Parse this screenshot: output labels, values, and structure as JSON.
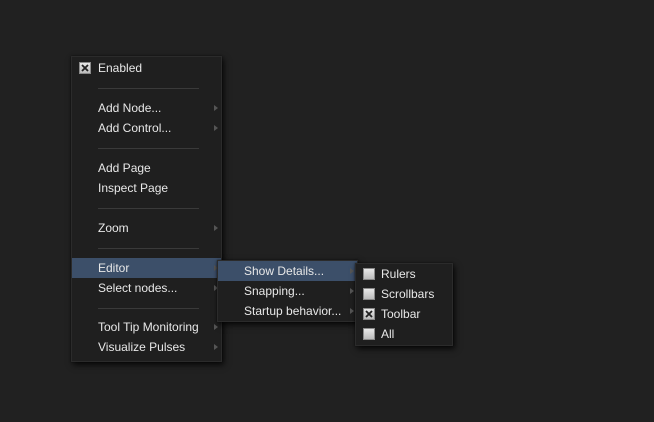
{
  "main_menu": {
    "enabled": {
      "label": "Enabled",
      "checked": true
    },
    "add_node": {
      "label": "Add Node..."
    },
    "add_control": {
      "label": "Add Control..."
    },
    "add_page": {
      "label": "Add Page"
    },
    "inspect_page": {
      "label": "Inspect Page"
    },
    "zoom": {
      "label": "Zoom"
    },
    "editor": {
      "label": "Editor"
    },
    "select_nodes": {
      "label": "Select nodes..."
    },
    "tool_tip_monitoring": {
      "label": "Tool Tip Monitoring"
    },
    "visualize_pulses": {
      "label": "Visualize Pulses"
    }
  },
  "editor_submenu": {
    "show_details": {
      "label": "Show Details..."
    },
    "snapping": {
      "label": "Snapping..."
    },
    "startup_behavior": {
      "label": "Startup behavior..."
    }
  },
  "show_details_submenu": {
    "rulers": {
      "label": "Rulers",
      "checked": false
    },
    "scrollbars": {
      "label": "Scrollbars",
      "checked": false
    },
    "toolbar": {
      "label": "Toolbar",
      "checked": true
    },
    "all": {
      "label": "All",
      "checked": false
    }
  },
  "colors": {
    "background": "#212121",
    "menu_background": "#1f1f1f",
    "highlight": "#3c4f69",
    "text": "#e8e8e8"
  },
  "icons": {
    "checkbox_checked": "checkbox-checked-icon",
    "checkbox_unchecked": "checkbox-unchecked-icon",
    "submenu_arrow": "chevron-right-icon"
  }
}
